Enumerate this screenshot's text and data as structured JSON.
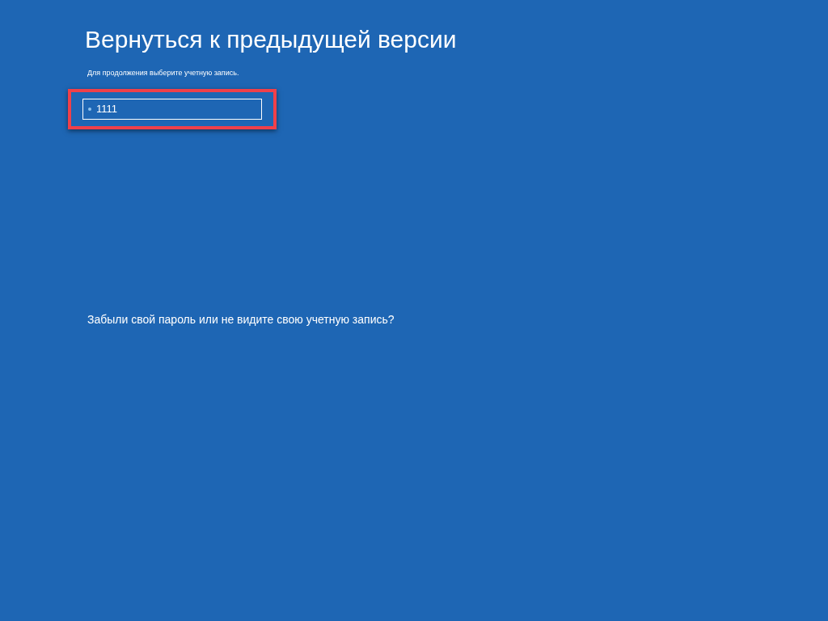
{
  "title": "Вернуться к предыдущей версии",
  "subtitle": "Для продолжения выберите учетную запись.",
  "accounts": [
    {
      "name": "1111",
      "selected": true
    }
  ],
  "highlight": true,
  "forgot_link": "Забыли свой пароль или не видите свою учетную запись?"
}
